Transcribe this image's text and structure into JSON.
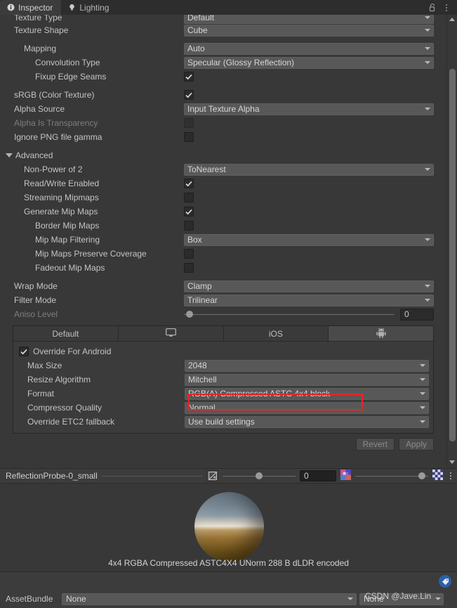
{
  "window": {
    "tabs": [
      {
        "label": "Inspector",
        "icon": "info-icon",
        "active": true
      },
      {
        "label": "Lighting",
        "icon": "lightbulb-icon",
        "active": false
      }
    ],
    "lock_icon": "padlock-open-icon",
    "menu_icon": "kebab-menu-icon"
  },
  "importer": {
    "texture_type": {
      "label": "Texture Type",
      "value": "Default"
    },
    "texture_shape": {
      "label": "Texture Shape",
      "value": "Cube"
    },
    "mapping": {
      "label": "Mapping",
      "value": "Auto"
    },
    "convolution_type": {
      "label": "Convolution Type",
      "value": "Specular (Glossy Reflection)"
    },
    "fixup_edge_seams": {
      "label": "Fixup Edge Seams",
      "checked": true
    },
    "srgb": {
      "label": "sRGB (Color Texture)",
      "checked": true
    },
    "alpha_source": {
      "label": "Alpha Source",
      "value": "Input Texture Alpha"
    },
    "alpha_is_transparency": {
      "label": "Alpha Is Transparency",
      "checked": false,
      "disabled": true
    },
    "ignore_png_gamma": {
      "label": "Ignore PNG file gamma",
      "checked": false
    },
    "advanced": {
      "label": "Advanced",
      "expanded": true
    },
    "non_power_of_2": {
      "label": "Non-Power of 2",
      "value": "ToNearest"
    },
    "read_write_enabled": {
      "label": "Read/Write Enabled",
      "checked": true
    },
    "streaming_mipmaps": {
      "label": "Streaming Mipmaps",
      "checked": false
    },
    "generate_mip_maps": {
      "label": "Generate Mip Maps",
      "checked": true
    },
    "border_mip_maps": {
      "label": "Border Mip Maps",
      "checked": false
    },
    "mip_map_filtering": {
      "label": "Mip Map Filtering",
      "value": "Box"
    },
    "mip_maps_preserve_coverage": {
      "label": "Mip Maps Preserve Coverage",
      "checked": false
    },
    "fadeout_mip_maps": {
      "label": "Fadeout Mip Maps",
      "checked": false
    },
    "wrap_mode": {
      "label": "Wrap Mode",
      "value": "Clamp"
    },
    "filter_mode": {
      "label": "Filter Mode",
      "value": "Trilinear"
    },
    "aniso_level": {
      "label": "Aniso Level",
      "value": "0",
      "disabled": true
    }
  },
  "platform": {
    "tabs": [
      {
        "label": "Default",
        "icon": "",
        "active": false
      },
      {
        "label": "",
        "icon": "monitor-icon",
        "active": false
      },
      {
        "label": "iOS",
        "icon": "",
        "active": false
      },
      {
        "label": "",
        "icon": "android-robot-icon",
        "active": true
      }
    ],
    "override": {
      "label": "Override For Android",
      "checked": true
    },
    "max_size": {
      "label": "Max Size",
      "value": "2048"
    },
    "resize_algorithm": {
      "label": "Resize Algorithm",
      "value": "Mitchell"
    },
    "format": {
      "label": "Format",
      "value": "RGB(A) Compressed ASTC 4x4 block",
      "highlight_color": "#e8252a"
    },
    "compressor_quality": {
      "label": "Compressor Quality",
      "value": "Normal"
    },
    "override_etc2": {
      "label": "Override ETC2 fallback",
      "value": "Use build settings"
    }
  },
  "actions": {
    "revert": "Revert",
    "apply": "Apply"
  },
  "preview": {
    "title": "ReflectionProbe-0_small",
    "mip_icon": "mip-level-icon",
    "mip_value": "0",
    "channel_icon": "rgb-channels-icon",
    "checker_icon": "checkerboard-icon",
    "menu_icon": "kebab-menu-icon",
    "caption": "4x4  RGBA Compressed ASTC4X4 UNorm   288 B   dLDR encoded"
  },
  "footer": {
    "tag_icon": "tag-icon",
    "assetbundle_label": "AssetBundle",
    "assetbundle_value": "None",
    "variant_value": "None",
    "watermark": "CSDN @Jave.Lin"
  },
  "colors": {
    "background": "#383838",
    "field": "#585858",
    "panel": "#3c3c3c",
    "accent_red": "#e8252a",
    "tag_blue": "#2c5fa8"
  }
}
